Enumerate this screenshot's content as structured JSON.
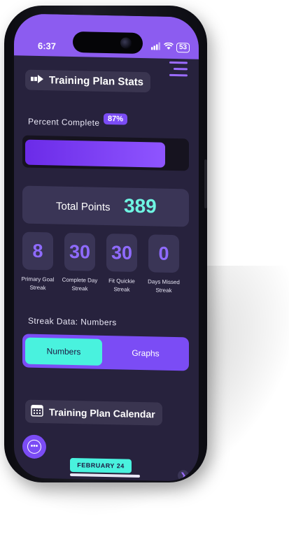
{
  "status_bar": {
    "time": "6:37",
    "battery": "53"
  },
  "stats": {
    "title": "Training Plan Stats",
    "title_icon": "arrow-right-icon",
    "percent_label": "Percent Complete",
    "percent_value": "87%",
    "progress_fraction": 0.87,
    "total_points_label": "Total Points",
    "total_points_value": "389",
    "streaks": [
      {
        "value": "8",
        "label": "Primary Goal Streak"
      },
      {
        "value": "30",
        "label": "Complete Day Streak"
      },
      {
        "value": "30",
        "label": "Fit Quickie Streak"
      },
      {
        "value": "0",
        "label": "Days Missed Streak"
      }
    ],
    "streak_data_label": "Streak Data: Numbers",
    "toggle": {
      "selected": "Numbers",
      "other": "Graphs"
    }
  },
  "calendar": {
    "title": "Training Plan Calendar",
    "title_icon": "calendar-icon",
    "month_label": "FEBRUARY 24"
  },
  "colors": {
    "accent": "#7b4cf5",
    "teal": "#49f2de",
    "background": "#27223d"
  }
}
